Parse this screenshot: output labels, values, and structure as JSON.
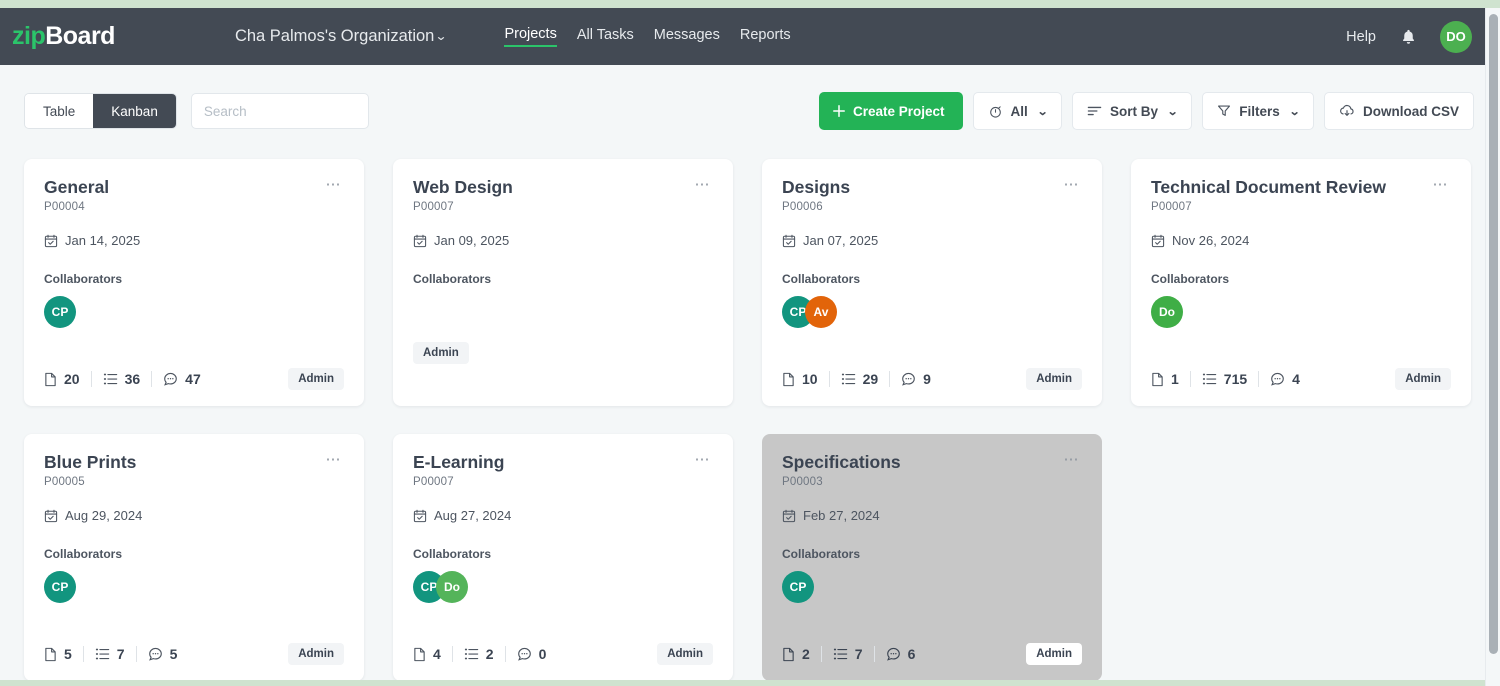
{
  "theme": {
    "navbar_bg": "#434a54",
    "accent_green": "#23b356",
    "logo_green": "#2bc46a",
    "page_bg": "#f4f7f8",
    "top_strip": "#cfe3cf",
    "selected_card_bg": "#c7c7c7"
  },
  "navbar": {
    "logo_zip": "zip",
    "logo_board": "Board",
    "organization": "Cha Palmos's Organization",
    "org_caret": "chevron-down-icon",
    "links": [
      {
        "label": "Projects",
        "active": true
      },
      {
        "label": "All Tasks",
        "active": false
      },
      {
        "label": "Messages",
        "active": false
      },
      {
        "label": "Reports",
        "active": false
      }
    ],
    "help_label": "Help",
    "notification_icon": "bell-icon",
    "user_avatar_initials": "DO",
    "user_avatar_color": "#4cb050"
  },
  "toolbar": {
    "view_modes": [
      {
        "label": "Table",
        "active": false
      },
      {
        "label": "Kanban",
        "active": true
      }
    ],
    "search_placeholder": "Search",
    "search_value": "",
    "create_label": "Create Project",
    "create_icon": "plus-icon",
    "all_label": "All",
    "all_icon": "stopwatch-icon",
    "sort_label": "Sort By",
    "sort_icon": "sort-lines-icon",
    "filters_label": "Filters",
    "filters_icon": "funnel-icon",
    "download_label": "Download CSV",
    "download_icon": "cloud-download-icon"
  },
  "cards": {
    "collaborators_label": "Collaborators",
    "menu_icon": "ellipsis-icon",
    "date_icon": "calendar-check-icon",
    "stat_icons": [
      "file-icon",
      "list-icon",
      "comment-icon"
    ],
    "items": [
      {
        "title": "General",
        "id": "P00004",
        "date": "Jan 14, 2025",
        "avatars": [
          {
            "initials": "CP",
            "color": "#12957f"
          }
        ],
        "stats": {
          "files": "20",
          "tasks": "36",
          "comments": "47"
        },
        "role": "Admin",
        "selected": false,
        "has_stats": true
      },
      {
        "title": "Web Design",
        "id": "P00007",
        "date": "Jan 09, 2025",
        "avatars": [],
        "stats": null,
        "role": "Admin",
        "selected": false,
        "has_stats": false
      },
      {
        "title": "Designs",
        "id": "P00006",
        "date": "Jan 07, 2025",
        "avatars": [
          {
            "initials": "CP",
            "color": "#12957f"
          },
          {
            "initials": "Av",
            "color": "#e2640a"
          }
        ],
        "stats": {
          "files": "10",
          "tasks": "29",
          "comments": "9"
        },
        "role": "Admin",
        "selected": false,
        "has_stats": true
      },
      {
        "title": "Technical Document Review",
        "id": "P00007",
        "date": "Nov 26, 2024",
        "avatars": [
          {
            "initials": "Do",
            "color": "#3fae46"
          }
        ],
        "stats": {
          "files": "1",
          "tasks": "715",
          "comments": "4"
        },
        "role": "Admin",
        "selected": false,
        "has_stats": true
      },
      {
        "title": "Blue Prints",
        "id": "P00005",
        "date": "Aug 29, 2024",
        "avatars": [
          {
            "initials": "CP",
            "color": "#12957f"
          }
        ],
        "stats": {
          "files": "5",
          "tasks": "7",
          "comments": "5"
        },
        "role": "Admin",
        "selected": false,
        "has_stats": true
      },
      {
        "title": "E-Learning",
        "id": "P00007",
        "date": "Aug 27, 2024",
        "avatars": [
          {
            "initials": "CP",
            "color": "#12957f"
          },
          {
            "initials": "Do",
            "color": "#54b45a"
          }
        ],
        "stats": {
          "files": "4",
          "tasks": "2",
          "comments": "0"
        },
        "role": "Admin",
        "selected": false,
        "has_stats": true
      },
      {
        "title": "Specifications",
        "id": "P00003",
        "date": "Feb 27, 2024",
        "avatars": [
          {
            "initials": "CP",
            "color": "#12957f"
          }
        ],
        "stats": {
          "files": "2",
          "tasks": "7",
          "comments": "6"
        },
        "role": "Admin",
        "selected": true,
        "has_stats": true
      }
    ]
  }
}
